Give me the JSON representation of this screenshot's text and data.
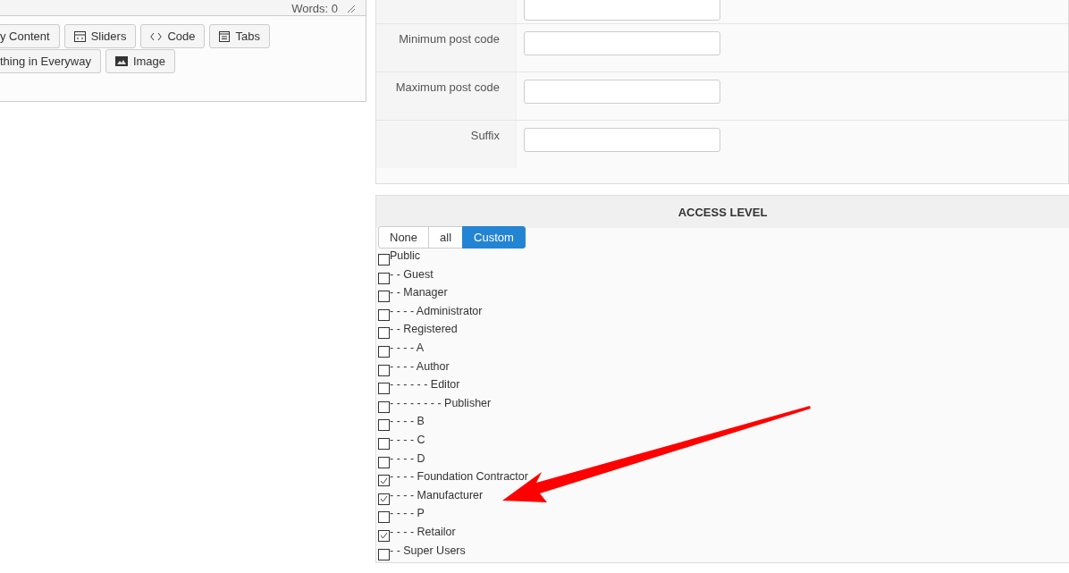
{
  "editor": {
    "word_count": "Words: 0",
    "button_rows": [
      [
        {
          "label": "y Content",
          "kind": "plain"
        },
        {
          "label": "Sliders",
          "kind": "sliders"
        },
        {
          "label": "Code",
          "kind": "code"
        },
        {
          "label": "Tabs",
          "kind": "tabs"
        }
      ],
      [
        {
          "label": "thing in Everyway",
          "kind": "plain"
        },
        {
          "label": "Image",
          "kind": "image"
        }
      ]
    ]
  },
  "form": {
    "rows": [
      {
        "label": "Minimum post code"
      },
      {
        "label": "Maximum post code"
      },
      {
        "label": "Suffix"
      }
    ]
  },
  "access_level": {
    "title": "ACCESS LEVEL",
    "modes": [
      {
        "label": "None",
        "selected": false
      },
      {
        "label": "all",
        "selected": false
      },
      {
        "label": "Custom",
        "selected": true
      }
    ],
    "groups": [
      {
        "label": "Public",
        "checked": false
      },
      {
        "label": "- - Guest",
        "checked": false
      },
      {
        "label": "- - Manager",
        "checked": false
      },
      {
        "label": "- - - - Administrator",
        "checked": false
      },
      {
        "label": "- - Registered",
        "checked": false
      },
      {
        "label": "- - - - A",
        "checked": false
      },
      {
        "label": "- - - - Author",
        "checked": false
      },
      {
        "label": "- - - - - - Editor",
        "checked": false
      },
      {
        "label": "- - - - - - - - Publisher",
        "checked": false
      },
      {
        "label": "- - - - B",
        "checked": false
      },
      {
        "label": "- - - - C",
        "checked": false
      },
      {
        "label": "- - - - D",
        "checked": false
      },
      {
        "label": "- - - - Foundation Contractor",
        "checked": true
      },
      {
        "label": "- - - - Manufacturer",
        "checked": true
      },
      {
        "label": "- - - - P",
        "checked": false
      },
      {
        "label": "- - - - Retailor",
        "checked": true
      },
      {
        "label": "- - Super Users",
        "checked": false
      }
    ]
  }
}
